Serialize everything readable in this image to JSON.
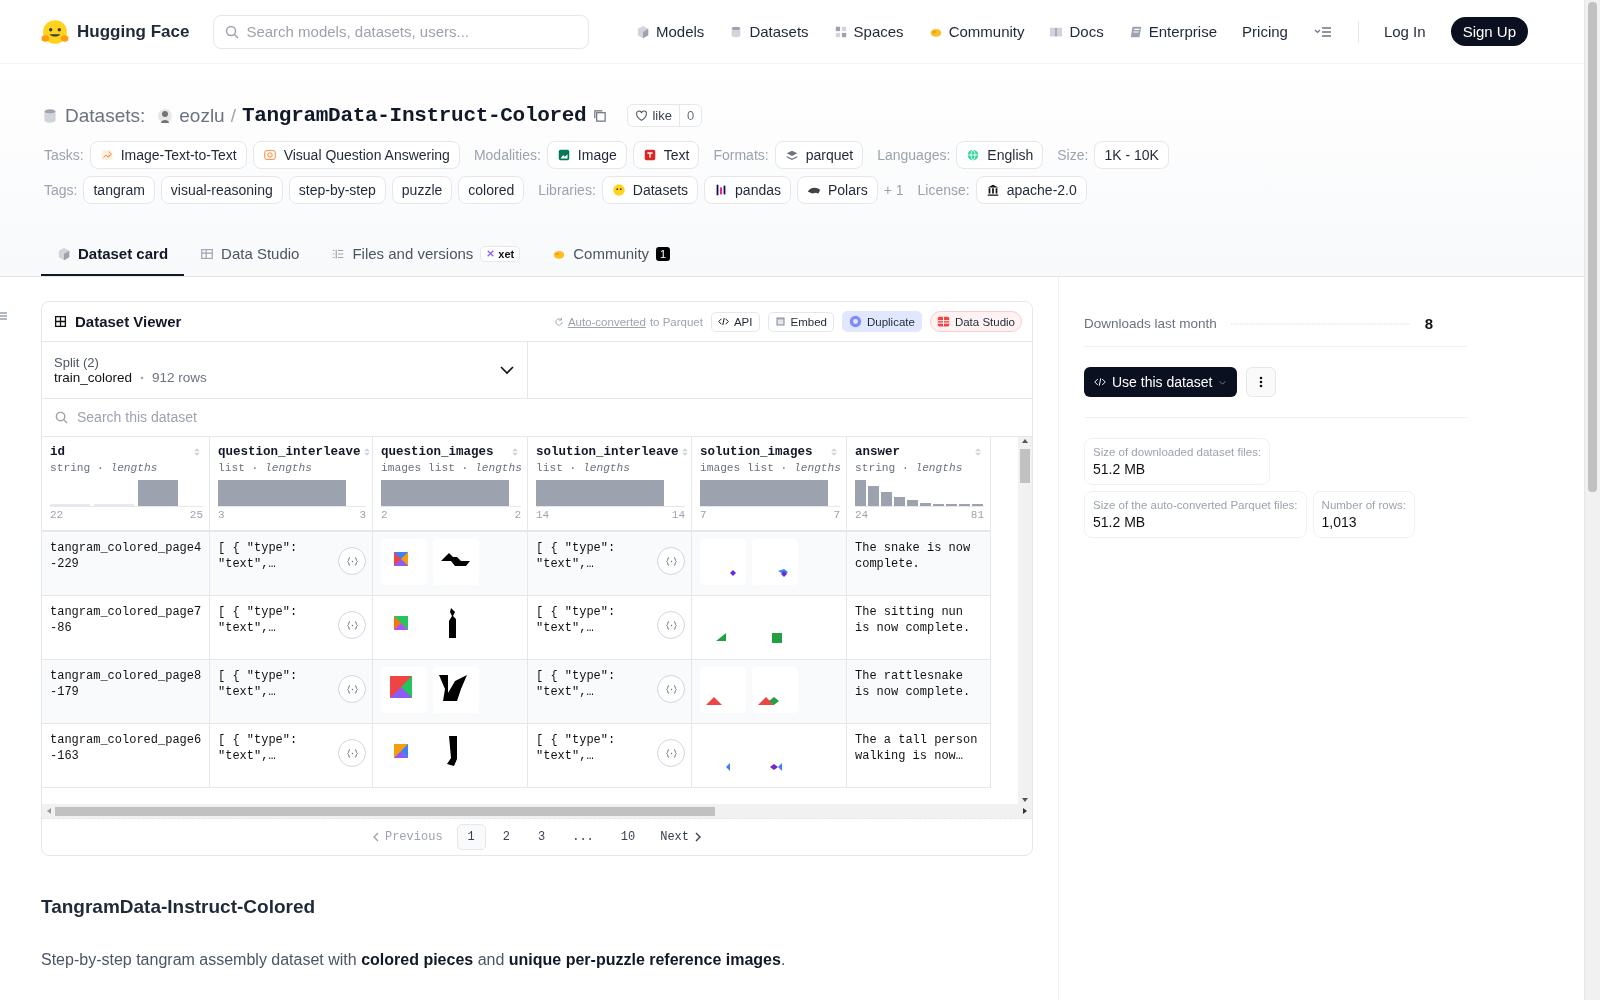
{
  "nav": {
    "brand": "Hugging Face",
    "search": {
      "placeholder": "Search models, datasets, users..."
    },
    "links": [
      "Models",
      "Datasets",
      "Spaces",
      "Community",
      "Docs",
      "Enterprise",
      "Pricing"
    ],
    "login": "Log In",
    "signup": "Sign Up"
  },
  "repo": {
    "type_label": "Datasets:",
    "owner": "eozlu",
    "separator": "/",
    "name": "TangramData-Instruct-Colored",
    "like": {
      "label": "like",
      "count": "0"
    }
  },
  "meta_rows": [
    [
      {
        "label": "Tasks:",
        "chips": [
          "Image-Text-to-Text",
          "Visual Question Answering"
        ]
      },
      {
        "label": "Modalities:",
        "chips": [
          "Image",
          "Text"
        ]
      },
      {
        "label": "Formats:",
        "chips": [
          "parquet"
        ]
      },
      {
        "label": "Languages:",
        "chips": [
          "English"
        ]
      },
      {
        "label": "Size:",
        "chips": [
          "1K - 10K"
        ]
      }
    ],
    [
      {
        "label": "Tags:",
        "chips": [
          "tangram",
          "visual-reasoning",
          "step-by-step",
          "puzzle",
          "colored"
        ]
      },
      {
        "label": "Libraries:",
        "chips": [
          "Datasets",
          "pandas",
          "Polars"
        ],
        "more": "+ 1"
      },
      {
        "label": "License:",
        "chips": [
          "apache-2.0"
        ]
      }
    ]
  ],
  "tabs": [
    {
      "label": "Dataset card",
      "selected": true
    },
    {
      "label": "Data Studio",
      "selected": false
    },
    {
      "label": "Files and versions",
      "selected": false,
      "badge": "xet"
    },
    {
      "label": "Community",
      "selected": false,
      "count": "1"
    }
  ],
  "viewer": {
    "title": "Dataset Viewer",
    "converted": {
      "link": "Auto-converted",
      "text": "to Parquet"
    },
    "actions": [
      {
        "label": "API",
        "kind": "plain"
      },
      {
        "label": "Embed",
        "kind": "plain"
      },
      {
        "label": "Duplicate",
        "kind": "duplicate"
      },
      {
        "label": "Data Studio",
        "kind": "studio"
      }
    ],
    "split": {
      "label": "Split (2)",
      "value": "train_colored",
      "rows": "912 rows"
    },
    "search": {
      "placeholder": "Search this dataset"
    },
    "columns": [
      {
        "name": "id",
        "type": "string · *lengths*",
        "min": "22",
        "max": "25"
      },
      {
        "name": "question_interleave",
        "type": "list · *lengths*",
        "min": "3",
        "max": "3"
      },
      {
        "name": "question_images",
        "type": "images list · *lengths*",
        "min": "2",
        "max": "2"
      },
      {
        "name": "solution_interleave",
        "type": "list · *lengths*",
        "min": "14",
        "max": "14"
      },
      {
        "name": "solution_images",
        "type": "images list · *lengths*",
        "min": "7",
        "max": "7"
      },
      {
        "name": "answer",
        "type": "string · *lengths*",
        "min": "24",
        "max": "81"
      }
    ],
    "rows": [
      {
        "id": "tangram_colored_page4-229",
        "question_interleave": "[ { \"type\": \"text\",…",
        "solution_interleave": "[ { \"type\": \"text\",…",
        "answer": "The snake is now complete."
      },
      {
        "id": "tangram_colored_page7-86",
        "question_interleave": "[ { \"type\": \"text\",…",
        "solution_interleave": "[ { \"type\": \"text\",…",
        "answer": "The sitting nun is now complete."
      },
      {
        "id": "tangram_colored_page8-179",
        "question_interleave": "[ { \"type\": \"text\",…",
        "solution_interleave": "[ { \"type\": \"text\",…",
        "answer": "The rattlesnake is now complete."
      },
      {
        "id": "tangram_colored_page6-163",
        "question_interleave": "[ { \"type\": \"text\",…",
        "solution_interleave": "[ { \"type\": \"text\",…",
        "answer": "The a tall person walking is now…"
      }
    ],
    "pagination": {
      "previous": "Previous",
      "pages": [
        {
          "label": "1",
          "selected": true,
          "kind": "page"
        },
        {
          "label": "2",
          "selected": false,
          "kind": "page"
        },
        {
          "label": "3",
          "selected": false,
          "kind": "page"
        },
        {
          "label": "...",
          "selected": false,
          "kind": "gap"
        },
        {
          "label": "10",
          "selected": false,
          "kind": "page"
        }
      ],
      "next": "Next"
    }
  },
  "sidebar": {
    "downloads": {
      "label": "Downloads last month",
      "value": "8"
    },
    "use_button": "Use this dataset",
    "stats": [
      {
        "label": "Size of downloaded dataset files:",
        "value": "51.2 MB"
      },
      {
        "label": "Size of the auto-converted Parquet files:",
        "value": "51.2 MB"
      },
      {
        "label": "Number of rows:",
        "value": "1,013"
      }
    ]
  },
  "readme": {
    "title": "TangramData-Instruct-Colored",
    "intro": "Step-by-step tangram assembly dataset with **colored pieces** and **unique per-puzzle reference images**."
  }
}
